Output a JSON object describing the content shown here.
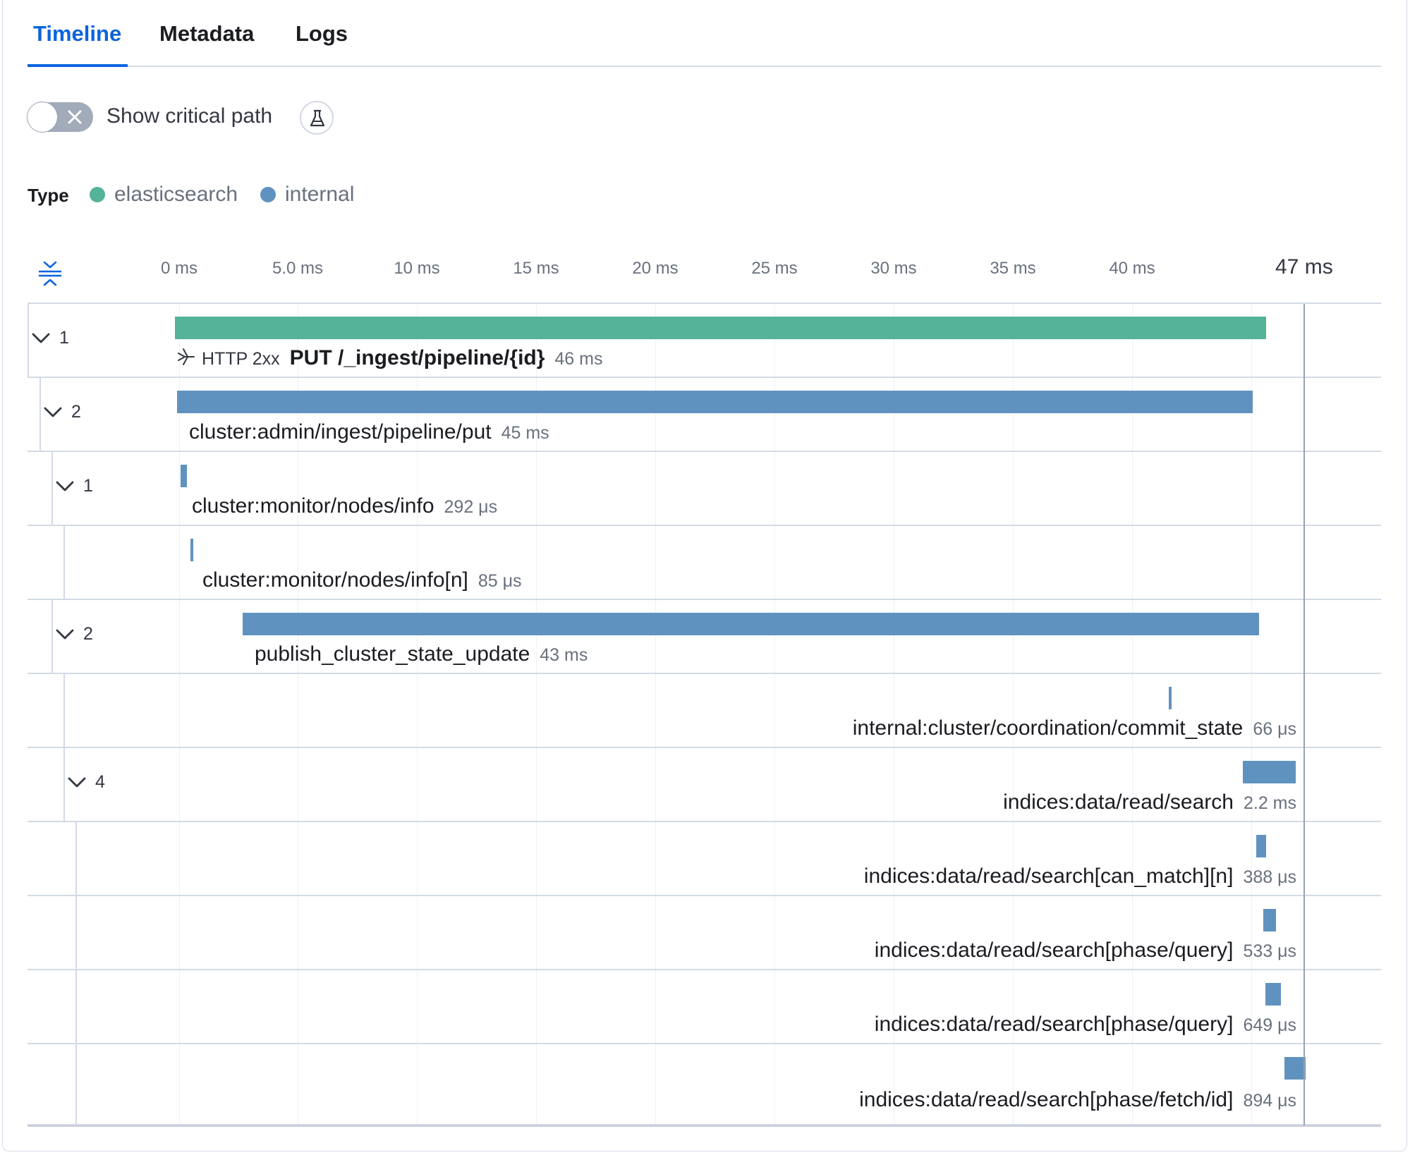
{
  "tabs": [
    {
      "label": "Timeline",
      "active": true
    },
    {
      "label": "Metadata",
      "active": false
    },
    {
      "label": "Logs",
      "active": false
    }
  ],
  "critical_path": {
    "label": "Show critical path",
    "enabled": false
  },
  "legend": {
    "title": "Type",
    "items": [
      {
        "label": "elasticsearch",
        "color": "#54b399"
      },
      {
        "label": "internal",
        "color": "#6092c0"
      }
    ]
  },
  "axis": {
    "ticks": [
      "0 ms",
      "5.0 ms",
      "10 ms",
      "15 ms",
      "20 ms",
      "25 ms",
      "30 ms",
      "35 ms",
      "40 ms"
    ],
    "total": "47 ms"
  },
  "spans": [
    {
      "toggle_count": "1",
      "http_status": "HTTP 2xx",
      "name": "PUT /_ingest/pipeline/{id}",
      "duration": "46 ms",
      "color": "#54b399"
    },
    {
      "toggle_count": "2",
      "name": "cluster:admin/ingest/pipeline/put",
      "duration": "45 ms",
      "color": "#6092c0"
    },
    {
      "toggle_count": "1",
      "name": "cluster:monitor/nodes/info",
      "duration": "292 μs",
      "color": "#6092c0"
    },
    {
      "toggle_count": "",
      "name": "cluster:monitor/nodes/info[n]",
      "duration": "85 μs",
      "color": "#6092c0"
    },
    {
      "toggle_count": "2",
      "name": "publish_cluster_state_update",
      "duration": "43 ms",
      "color": "#6092c0"
    },
    {
      "toggle_count": "",
      "name": "internal:cluster/coordination/commit_state",
      "duration": "66 μs",
      "color": "#6092c0"
    },
    {
      "toggle_count": "4",
      "name": "indices:data/read/search",
      "duration": "2.2 ms",
      "color": "#6092c0"
    },
    {
      "toggle_count": "",
      "name": "indices:data/read/search[can_match][n]",
      "duration": "388 μs",
      "color": "#6092c0"
    },
    {
      "toggle_count": "",
      "name": "indices:data/read/search[phase/query]",
      "duration": "533 μs",
      "color": "#6092c0"
    },
    {
      "toggle_count": "",
      "name": "indices:data/read/search[phase/query]",
      "duration": "649 μs",
      "color": "#6092c0"
    },
    {
      "toggle_count": "",
      "name": "indices:data/read/search[phase/fetch/id]",
      "duration": "894 μs",
      "color": "#6092c0"
    }
  ]
}
